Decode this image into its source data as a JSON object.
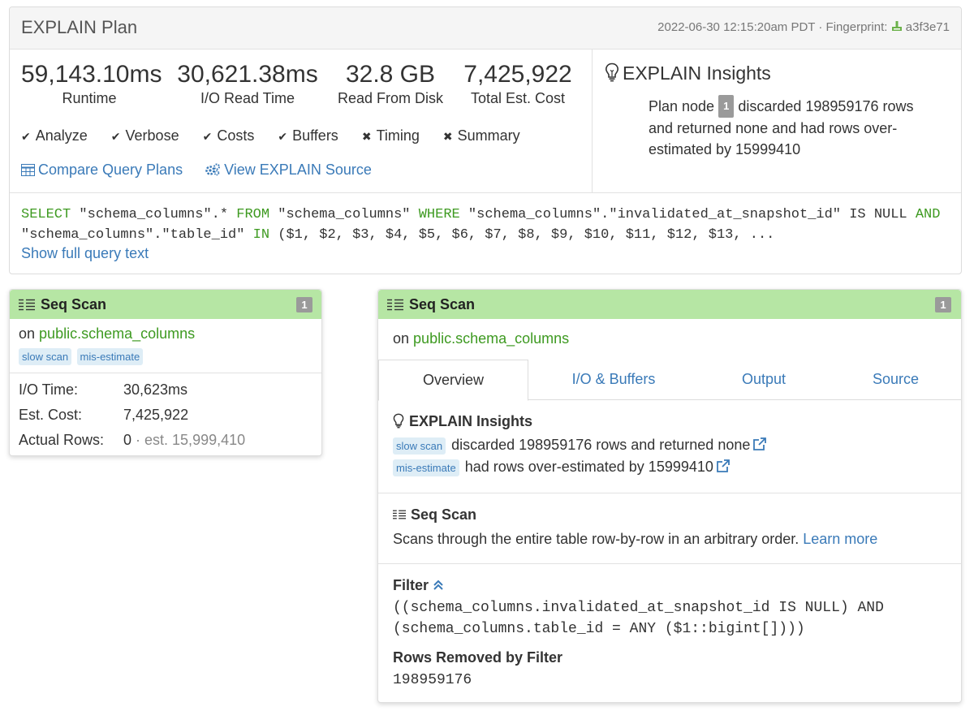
{
  "header": {
    "title": "EXPLAIN Plan",
    "timestamp": "2022-06-30 12:15:20am PDT",
    "fingerprint_label": "Fingerprint:",
    "fingerprint": "a3f3e71"
  },
  "stats": [
    {
      "value": "59,143.10ms",
      "label": "Runtime"
    },
    {
      "value": "30,621.38ms",
      "label": "I/O Read Time"
    },
    {
      "value": "32.8 GB",
      "label": "Read From Disk"
    },
    {
      "value": "7,425,922",
      "label": "Total Est. Cost"
    }
  ],
  "flags": [
    {
      "label": "Analyze",
      "enabled": true,
      "mark": "✔"
    },
    {
      "label": "Verbose",
      "enabled": true,
      "mark": "✔"
    },
    {
      "label": "Costs",
      "enabled": true,
      "mark": "✔"
    },
    {
      "label": "Buffers",
      "enabled": true,
      "mark": "✔"
    },
    {
      "label": "Timing",
      "enabled": false,
      "mark": "✖"
    },
    {
      "label": "Summary",
      "enabled": false,
      "mark": "✖"
    }
  ],
  "links": {
    "compare": "Compare Query Plans",
    "view_source": "View EXPLAIN Source"
  },
  "insights": {
    "title": "EXPLAIN Insights",
    "text_before": "Plan node",
    "node_number": "1",
    "text_after": "discarded 198959176 rows and returned none and had rows over-estimated by 15999410"
  },
  "query": {
    "kw_select": "SELECT",
    "seg1": " \"schema_columns\".* ",
    "kw_from": "FROM",
    "seg2": " \"schema_columns\" ",
    "kw_where": "WHERE",
    "seg3": " \"schema_columns\".\"invalidated_at_snapshot_id\" IS NULL ",
    "kw_and": "AND",
    "seg4": "\"schema_columns\".\"table_id\" ",
    "kw_in": "IN",
    "seg5": " ($1, $2, $3, $4, $5, $6, $7, $8, $9, $10, $11, $12, $13, ...",
    "show_full": "Show full query text"
  },
  "node_card": {
    "title": "Seq Scan",
    "badge": "1",
    "on_prefix": "on",
    "relation": "public.schema_columns",
    "tags": [
      "slow scan",
      "mis-estimate"
    ],
    "rows": [
      {
        "label": "I/O Time:",
        "value": "30,623ms",
        "est": ""
      },
      {
        "label": "Est. Cost:",
        "value": "7,425,922",
        "est": ""
      },
      {
        "label": "Actual Rows:",
        "value": "0",
        "est": "· est. 15,999,410"
      }
    ]
  },
  "detail": {
    "title": "Seq Scan",
    "badge": "1",
    "on_prefix": "on",
    "relation": "public.schema_columns",
    "tabs": [
      "Overview",
      "I/O & Buffers",
      "Output",
      "Source"
    ],
    "insights_title": "EXPLAIN Insights",
    "insight_items": [
      {
        "tag": "slow scan",
        "text": "discarded 198959176 rows and returned none"
      },
      {
        "tag": "mis-estimate",
        "text": "had rows over-estimated by 15999410"
      }
    ],
    "seq_title": "Seq Scan",
    "seq_desc": "Scans through the entire table row-by-row in an arbitrary order.",
    "learn_more": "Learn more",
    "filter_title": "Filter",
    "filter_line1": "((schema_columns.invalidated_at_snapshot_id IS NULL) AND",
    "filter_line2": "(schema_columns.table_id = ANY ($1::bigint[])))",
    "rows_removed_title": "Rows Removed by Filter",
    "rows_removed_value": "198959176"
  },
  "colors": {
    "accent_link": "#3a7ab8",
    "keyword_green": "#3e9a21",
    "node_header_bg": "#b6e6a4",
    "tag_bg": "#deedf6"
  }
}
